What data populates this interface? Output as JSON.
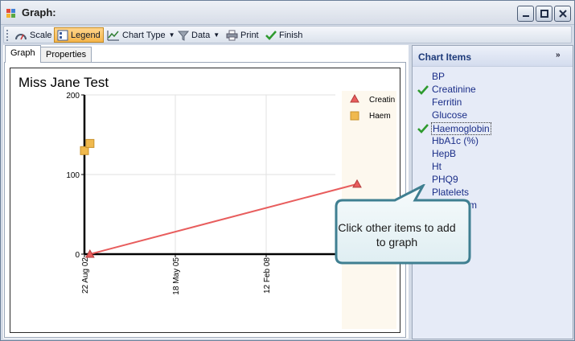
{
  "window": {
    "title": "Graph:"
  },
  "toolbar": {
    "scale": "Scale",
    "legend": "Legend",
    "chart_type": "Chart Type",
    "data": "Data",
    "print": "Print",
    "finish": "Finish"
  },
  "tabs": {
    "graph": "Graph",
    "properties": "Properties"
  },
  "chart_data": {
    "type": "line",
    "title": "Miss Jane Test",
    "ylim": [
      0,
      200
    ],
    "y_ticks": [
      "200",
      "100",
      "0"
    ],
    "x_ticks": [
      "22 Aug 02",
      "18 May 05",
      "12 Feb 08"
    ],
    "series": [
      {
        "name": "Creatinine",
        "color": "#e85d5d",
        "marker": "triangle",
        "x": [
          "Oct 02",
          "Nov 10"
        ],
        "values": [
          0,
          88
        ]
      },
      {
        "name": "Haemoglobin",
        "color": "#f0b94e",
        "marker": "square",
        "x": [
          "Aug 02",
          "Oct 02"
        ],
        "values": [
          130,
          139
        ]
      }
    ],
    "legend": {
      "placement": "right",
      "labels": [
        "Creatin",
        "Haem"
      ]
    }
  },
  "chart_items": {
    "title": "Chart Items",
    "items": [
      {
        "label": "BP",
        "checked": false
      },
      {
        "label": "Creatinine",
        "checked": true
      },
      {
        "label": "Ferritin",
        "checked": false
      },
      {
        "label": "Glucose",
        "checked": false
      },
      {
        "label": "Haemoglobin",
        "checked": true
      },
      {
        "label": "HbA1c (%)",
        "checked": false
      },
      {
        "label": "HepB",
        "checked": false
      },
      {
        "label": "Ht",
        "checked": false
      },
      {
        "label": "PHQ9",
        "checked": false
      },
      {
        "label": "Platelets",
        "checked": false
      },
      {
        "label": "Potassium",
        "checked": false
      }
    ]
  },
  "callout": {
    "text": "Click other items to add to graph"
  }
}
